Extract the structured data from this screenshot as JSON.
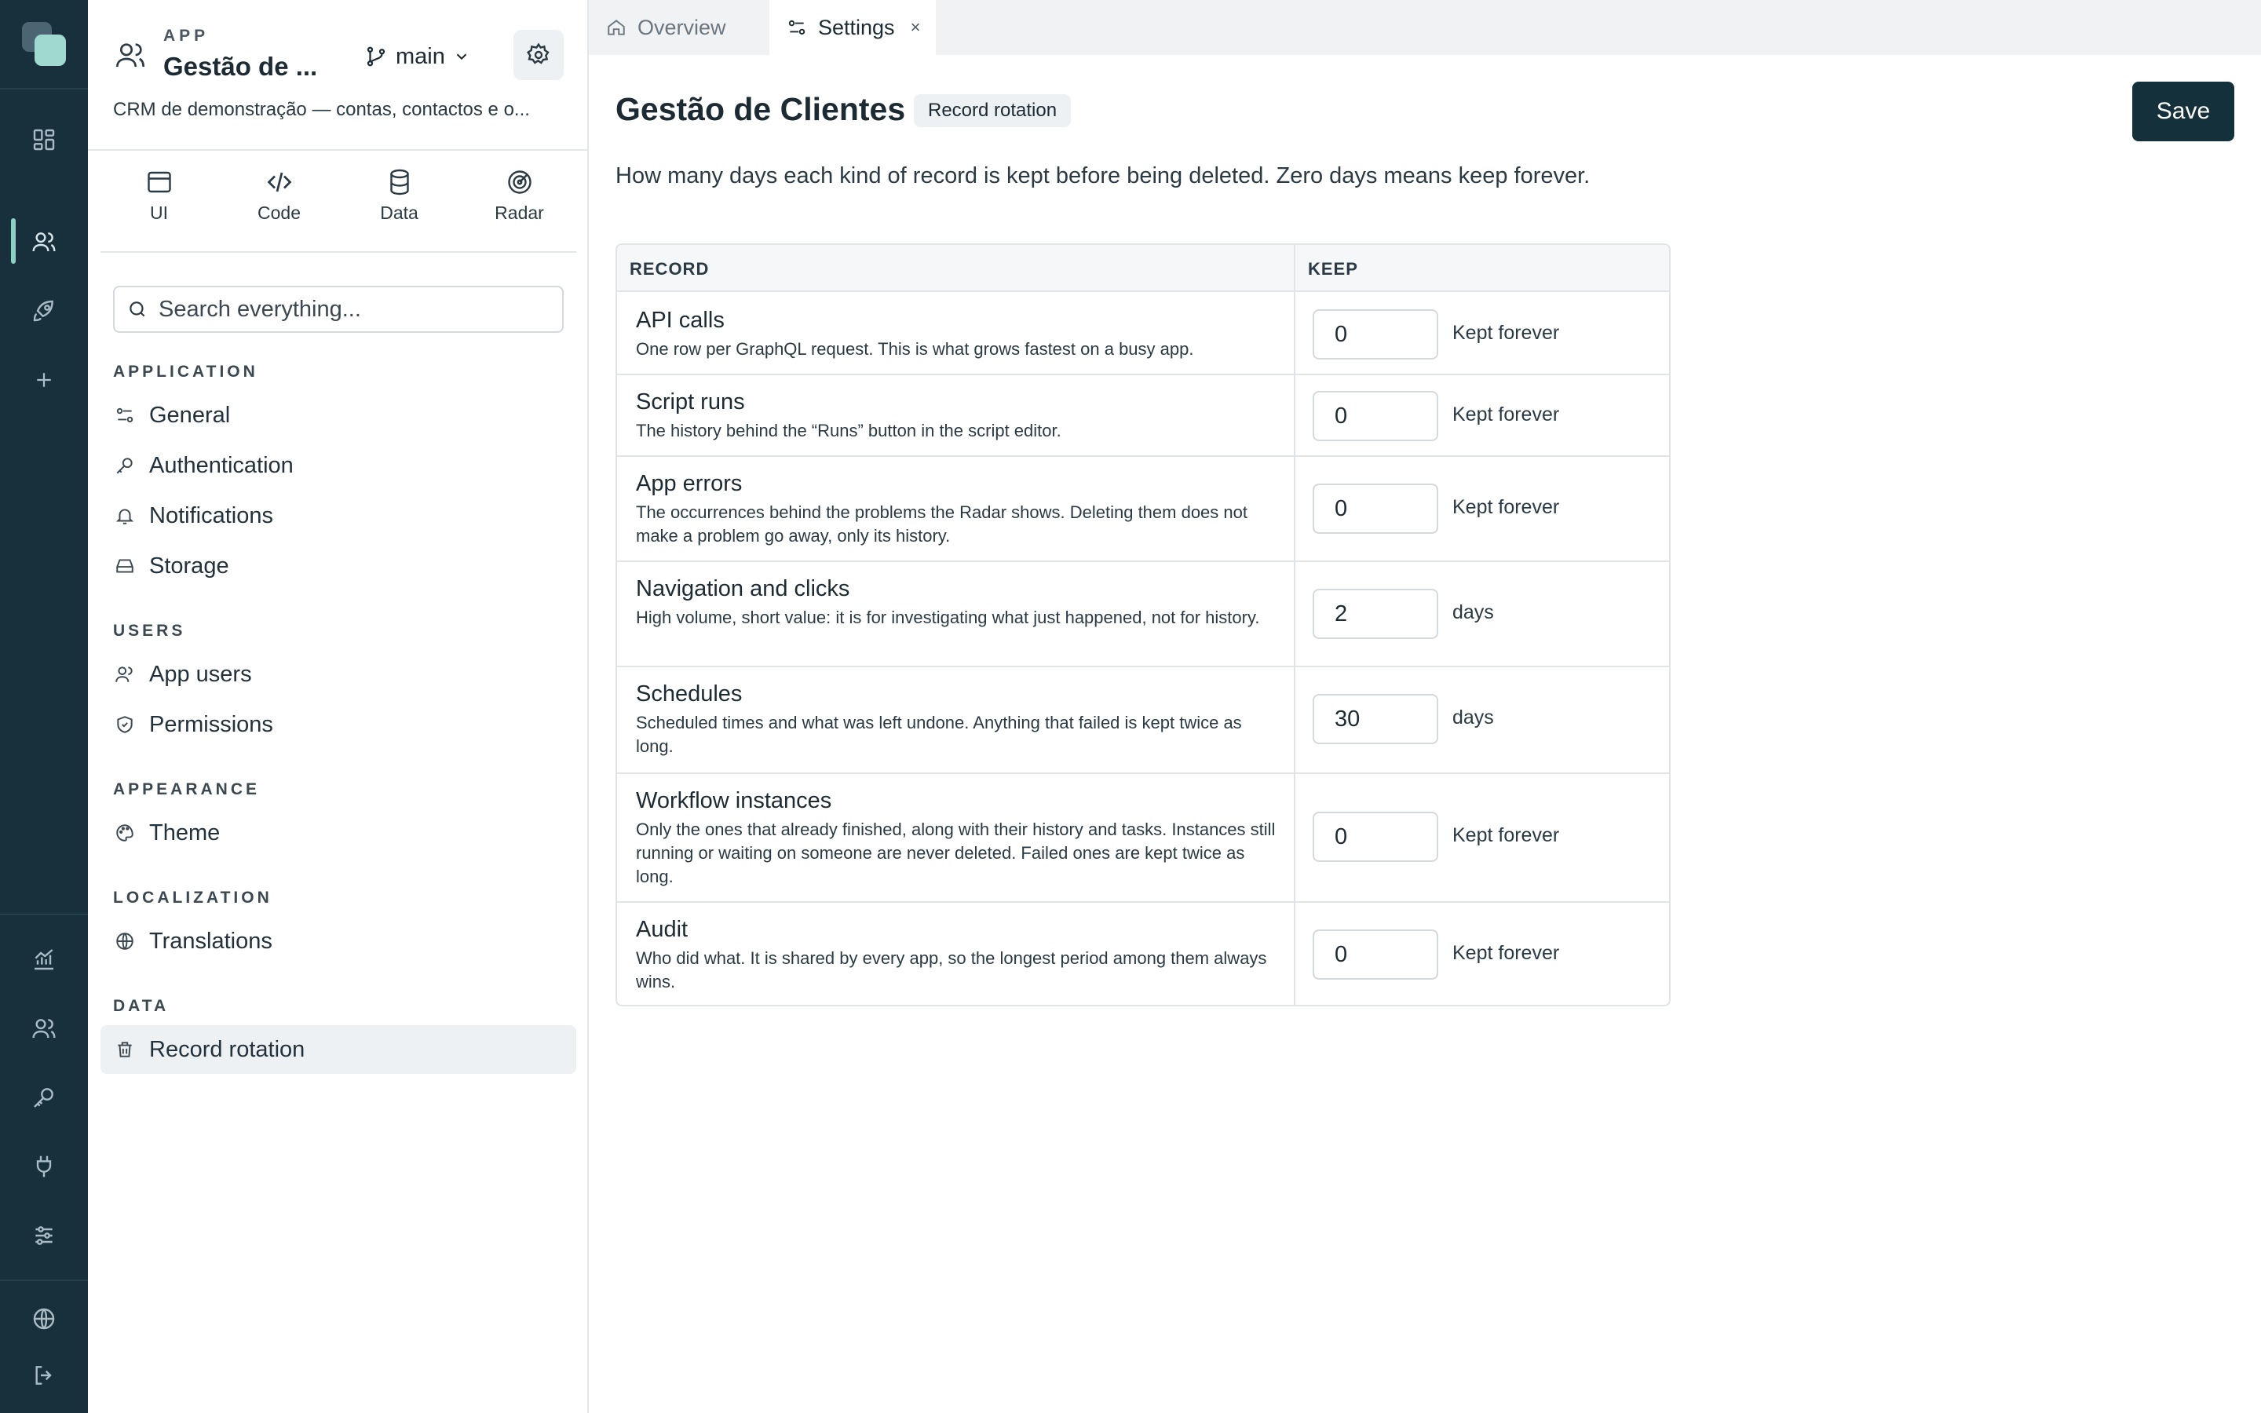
{
  "app": {
    "kicker": "APP",
    "name": "Gestão de ...",
    "branch": "main",
    "description": "CRM de demonstração — contas, contactos e o..."
  },
  "mode_tabs": [
    {
      "label": "UI",
      "icon": "window-icon"
    },
    {
      "label": "Code",
      "icon": "code-icon"
    },
    {
      "label": "Data",
      "icon": "database-icon"
    },
    {
      "label": "Radar",
      "icon": "radar-icon"
    }
  ],
  "search": {
    "placeholder": "Search everything..."
  },
  "nav": {
    "application": {
      "title": "APPLICATION",
      "items": [
        {
          "label": "General",
          "icon": "sliders-icon"
        },
        {
          "label": "Authentication",
          "icon": "key-icon"
        },
        {
          "label": "Notifications",
          "icon": "bell-icon"
        },
        {
          "label": "Storage",
          "icon": "storage-icon"
        }
      ]
    },
    "users": {
      "title": "USERS",
      "items": [
        {
          "label": "App users",
          "icon": "users-icon"
        },
        {
          "label": "Permissions",
          "icon": "shield-icon"
        }
      ]
    },
    "appearance": {
      "title": "APPEARANCE",
      "items": [
        {
          "label": "Theme",
          "icon": "palette-icon"
        }
      ]
    },
    "localization": {
      "title": "LOCALIZATION",
      "items": [
        {
          "label": "Translations",
          "icon": "globe-icon"
        }
      ]
    },
    "data": {
      "title": "DATA",
      "items": [
        {
          "label": "Record rotation",
          "icon": "trash-icon",
          "selected": true
        }
      ]
    }
  },
  "tabs": [
    {
      "label": "Overview",
      "icon": "home-icon",
      "active": false
    },
    {
      "label": "Settings",
      "icon": "sliders-icon",
      "active": true,
      "close": "×"
    }
  ],
  "page": {
    "title": "Gestão de Clientes",
    "badge": "Record rotation",
    "save_label": "Save",
    "intro": "How many days each kind of record is kept before being deleted. Zero days means keep forever."
  },
  "table": {
    "headers": [
      "RECORD",
      "KEEP"
    ],
    "rows": [
      {
        "title": "API calls",
        "description": "One row per GraphQL request. This is what grows fastest on a busy app.",
        "value": "0",
        "unit": "Kept forever"
      },
      {
        "title": "Script runs",
        "description": "The history behind the “Runs” button in the script editor.",
        "value": "0",
        "unit": "Kept forever"
      },
      {
        "title": "App errors",
        "description": "The occurrences behind the problems the Radar shows. Deleting them does not make a problem go away, only its history.",
        "value": "0",
        "unit": "Kept forever"
      },
      {
        "title": "Navigation and clicks",
        "description": "High volume, short value: it is for investigating what just happened, not for history.",
        "value": "2",
        "unit": "days"
      },
      {
        "title": "Schedules",
        "description": "Scheduled times and what was left undone. Anything that failed is kept twice as long.",
        "value": "30",
        "unit": "days"
      },
      {
        "title": "Workflow instances",
        "description": "Only the ones that already finished, along with their history and tasks. Instances still running or waiting on someone are never deleted. Failed ones are kept twice as long.",
        "value": "0",
        "unit": "Kept forever"
      },
      {
        "title": "Audit",
        "description": "Who did what. It is shared by every app, so the longest period among them always wins.",
        "value": "0",
        "unit": "Kept forever"
      }
    ]
  },
  "rail": {
    "top_icons": [
      "dashboard-icon",
      "users-icon",
      "rocket-icon",
      "plus-icon"
    ],
    "bottom_icons": [
      "chart-icon",
      "users-icon",
      "key-icon",
      "plug-icon",
      "sliders-icon",
      "globe-icon",
      "logout-icon"
    ]
  },
  "colors": {
    "rail_bg": "#17303c",
    "accent": "#8ccfc4",
    "save_bg": "#14303b"
  }
}
